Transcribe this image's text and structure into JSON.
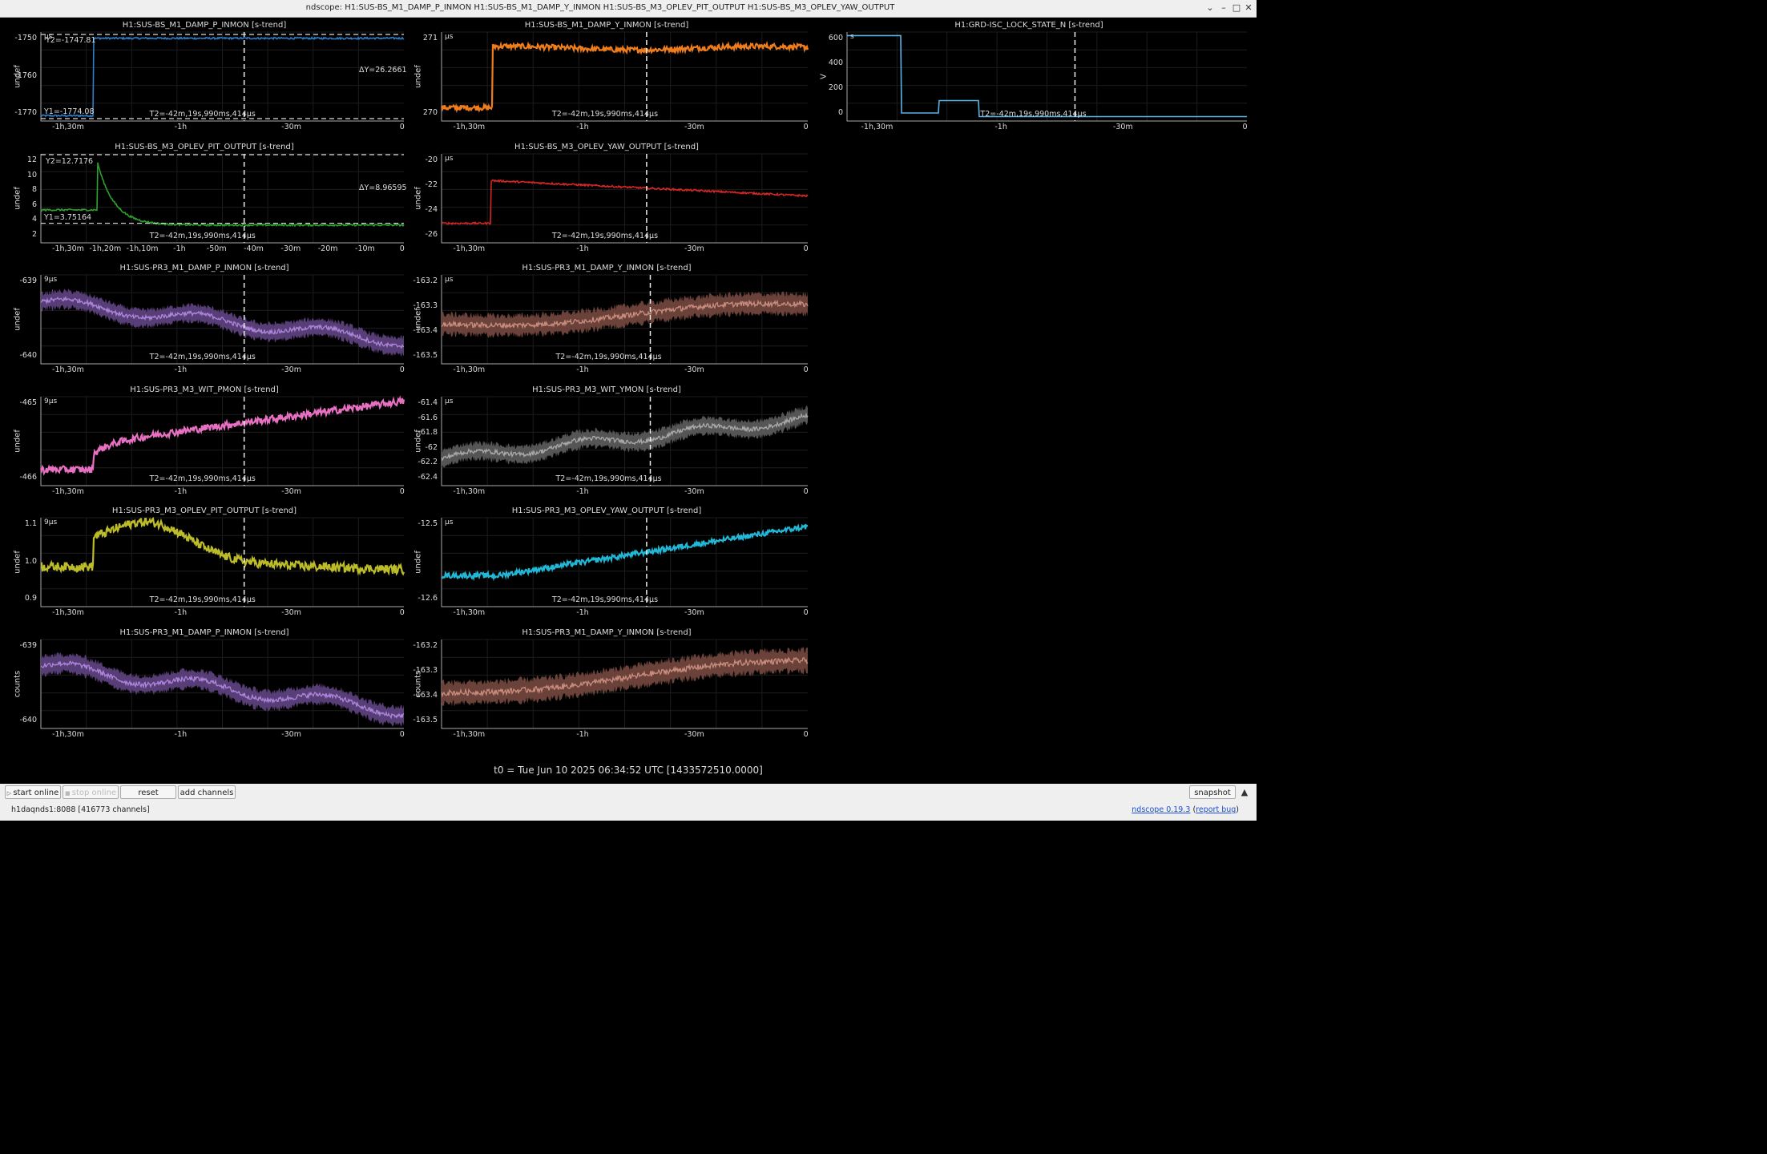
{
  "window": {
    "title": "ndscope: H1:SUS-BS_M1_DAMP_P_INMON H1:SUS-BS_M1_DAMP_Y_INMON H1:SUS-BS_M3_OPLEV_PIT_OUTPUT H1:SUS-BS_M3_OPLEV_YAW_OUTPUT"
  },
  "t0": "t0 = Tue Jun 10 2025 06:34:52 UTC [1433572510.0000]",
  "toolbar": {
    "start_online": "start online",
    "stop_online": "stop online",
    "reset": "reset",
    "add_channels": "add channels",
    "snapshot": "snapshot"
  },
  "status": {
    "server": "h1daqnds1:8088",
    "channels": "[416773 channels]",
    "app_link": "ndscope 0.19.3",
    "report_bug": "report bug"
  },
  "colors": {
    "bs_p": "#2c7fc8",
    "bs_y": "#f07d1b",
    "grd": "#5ab4e8",
    "oplev_pit": "#2ea12e",
    "oplev_yaw": "#d42626",
    "pr3_p": "#a070d6",
    "pr3_y": "#c07868",
    "wit_p": "#e870c2",
    "wit_y": "#9a9a9a",
    "pr3_oplev_pit": "#bcbc2a",
    "pr3_oplev_yaw": "#20b8d6"
  },
  "plots": [
    {
      "id": "p1",
      "title": "H1:SUS-BS_M1_DAMP_P_INMON [s-trend]",
      "ylabel": "undef",
      "units": "μs",
      "yticks": [
        "-1750",
        "-1760",
        "-1770"
      ],
      "xticks": [
        "-1h,30m",
        "-1h",
        "-30m",
        "0"
      ],
      "cursorT": "T2=-42m,19s,990ms,414μs",
      "y2": "Y2=-1747.81",
      "y1": "Y1=-1774.08",
      "dy": "ΔY=26.2661",
      "color": "bs_p"
    },
    {
      "id": "p2",
      "title": "H1:SUS-BS_M1_DAMP_Y_INMON [s-trend]",
      "ylabel": "undef",
      "units": "μs",
      "yticks": [
        "271",
        "270"
      ],
      "xticks": [
        "-1h,30m",
        "-1h",
        "-30m",
        "0"
      ],
      "cursorT": "T2=-42m,19s,990ms,414μs",
      "color": "bs_y"
    },
    {
      "id": "p3",
      "title": "H1:GRD-ISC_LOCK_STATE_N [s-trend]",
      "ylabel": "V",
      "units": "s",
      "yticks": [
        "600",
        "400",
        "200",
        "0"
      ],
      "xticks": [
        "-1h,30m",
        "-1h",
        "-30m",
        "0"
      ],
      "cursorT": "T2=-42m,19s,990ms,414μs",
      "color": "grd"
    },
    {
      "id": "p4",
      "title": "H1:SUS-BS_M3_OPLEV_PIT_OUTPUT [s-trend]",
      "ylabel": "undef",
      "units": "",
      "yticks": [
        "12",
        "10",
        "8",
        "6",
        "4",
        "2"
      ],
      "xticks": [
        "-1h,30m",
        "-1h,20m",
        "-1h,10m",
        "-1h",
        "-50m",
        "-40m",
        "-30m",
        "-20m",
        "-10m",
        "0"
      ],
      "cursorT": "T2=-42m,19s,990ms,414μs",
      "y2": "Y2=12.7176",
      "y1": "Y1=3.75164",
      "dy": "ΔY=8.96595",
      "color": "oplev_pit"
    },
    {
      "id": "p5",
      "title": "H1:SUS-BS_M3_OPLEV_YAW_OUTPUT [s-trend]",
      "ylabel": "undef",
      "units": "μs",
      "yticks": [
        "-20",
        "-22",
        "-24",
        "-26"
      ],
      "xticks": [
        "-1h,30m",
        "-1h",
        "-30m",
        "0"
      ],
      "cursorT": "T2=-42m,19s,990ms,414μs",
      "color": "oplev_yaw"
    },
    {
      "id": "p6",
      "title": "H1:SUS-PR3_M1_DAMP_P_INMON [s-trend]",
      "ylabel": "undef",
      "units": "9μs",
      "yticks": [
        "-639",
        "-640"
      ],
      "xticks": [
        "-1h,30m",
        "-1h",
        "-30m",
        "0"
      ],
      "cursorT": "T2=-42m,19s,990ms,414μs",
      "color": "pr3_p"
    },
    {
      "id": "p7",
      "title": "H1:SUS-PR3_M1_DAMP_Y_INMON [s-trend]",
      "ylabel": "undef",
      "units": "μs",
      "yticks": [
        "-163.2",
        "-163.3",
        "-163.4",
        "-163.5"
      ],
      "xticks": [
        "-1h,30m",
        "-1h",
        "-30m",
        "0"
      ],
      "cursorT": "T2=-42m,19s,990ms,414μs",
      "color": "pr3_y"
    },
    {
      "id": "p8",
      "title": "H1:SUS-PR3_M3_WIT_PMON [s-trend]",
      "ylabel": "undef",
      "units": "9μs",
      "yticks": [
        "-465",
        "-466"
      ],
      "xticks": [
        "-1h,30m",
        "-1h",
        "-30m",
        "0"
      ],
      "cursorT": "T2=-42m,19s,990ms,414μs",
      "color": "wit_p"
    },
    {
      "id": "p9",
      "title": "H1:SUS-PR3_M3_WIT_YMON [s-trend]",
      "ylabel": "undef",
      "units": "μs",
      "yticks": [
        "-61.4",
        "-61.6",
        "-61.8",
        "-62",
        "-62.2",
        "-62.4"
      ],
      "xticks": [
        "-1h,30m",
        "-1h",
        "-30m",
        "0"
      ],
      "cursorT": "T2=-42m,19s,990ms,414μs",
      "color": "wit_y"
    },
    {
      "id": "p10",
      "title": "H1:SUS-PR3_M3_OPLEV_PIT_OUTPUT [s-trend]",
      "ylabel": "undef",
      "units": "9μs",
      "yticks": [
        "1.1",
        "1.0",
        "0.9"
      ],
      "xticks": [
        "-1h,30m",
        "-1h",
        "-30m",
        "0"
      ],
      "cursorT": "T2=-42m,19s,990ms,414μs",
      "color": "pr3_oplev_pit"
    },
    {
      "id": "p11",
      "title": "H1:SUS-PR3_M3_OPLEV_YAW_OUTPUT [s-trend]",
      "ylabel": "undef",
      "units": "μs",
      "yticks": [
        "-12.5",
        "-12.6"
      ],
      "xticks": [
        "-1h,30m",
        "-1h",
        "-30m",
        "0"
      ],
      "cursorT": "T2=-42m,19s,990ms,414μs",
      "color": "pr3_oplev_yaw"
    },
    {
      "id": "p12",
      "title": "H1:SUS-PR3_M1_DAMP_P_INMON [s-trend]",
      "ylabel": "counts",
      "units": "",
      "yticks": [
        "-639",
        "-640"
      ],
      "xticks": [
        "-1h,30m",
        "-1h",
        "-30m",
        "0"
      ],
      "cursorT": "",
      "color": "pr3_p"
    },
    {
      "id": "p13",
      "title": "H1:SUS-PR3_M1_DAMP_Y_INMON [s-trend]",
      "ylabel": "counts",
      "units": "",
      "yticks": [
        "-163.2",
        "-163.3",
        "-163.4",
        "-163.5"
      ],
      "xticks": [
        "-1h,30m",
        "-1h",
        "-30m",
        "0"
      ],
      "cursorT": "",
      "color": "pr3_y"
    }
  ]
}
